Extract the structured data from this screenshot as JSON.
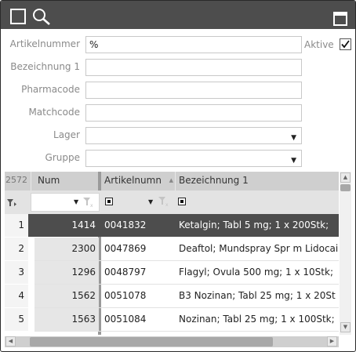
{
  "form": {
    "artikelnummer": {
      "label": "Artikelnummer",
      "value": "%"
    },
    "bezeichnung": {
      "label": "Bezeichnung 1",
      "value": ""
    },
    "pharmacode": {
      "label": "Pharmacode",
      "value": ""
    },
    "matchcode": {
      "label": "Matchcode",
      "value": ""
    },
    "lager": {
      "label": "Lager",
      "value": ""
    },
    "gruppe": {
      "label": "Gruppe",
      "value": ""
    },
    "aktive": {
      "label": "Aktive",
      "checked": true
    }
  },
  "grid": {
    "count": "2572",
    "columns": {
      "num": "Num",
      "artikelnummer": "Artikelnumn",
      "bezeichnung": "Bezeichnung 1"
    },
    "rows": [
      {
        "index": "1",
        "num": "1414",
        "artikelnummer": "0041832",
        "bezeichnung": "Ketalgin; Tabl 5 mg; 1 x 200Stk;",
        "selected": true
      },
      {
        "index": "2",
        "num": "2300",
        "artikelnummer": "0047869",
        "bezeichnung": "Deaftol; Mundspray Spr m Lidocai"
      },
      {
        "index": "3",
        "num": "1296",
        "artikelnummer": "0048797",
        "bezeichnung": "Flagyl; Ovula 500 mg; 1 x 10Stk;"
      },
      {
        "index": "4",
        "num": "1562",
        "artikelnummer": "0051078",
        "bezeichnung": "B3 Nozinan; Tabl 25 mg; 1 x 20St"
      },
      {
        "index": "5",
        "num": "1563",
        "artikelnummer": "0051084",
        "bezeichnung": "Nozinan; Tabl 25 mg; 1 x 100Stk;"
      }
    ]
  },
  "colors": {
    "titlebar": "#4d4d4d",
    "selected_row": "#4d4d4d",
    "header": "#cfcfcf"
  },
  "icons": [
    "square-icon",
    "search-icon",
    "maximize-icon",
    "filter-icon",
    "dropdown-arrow-icon",
    "checkbox-icon"
  ]
}
